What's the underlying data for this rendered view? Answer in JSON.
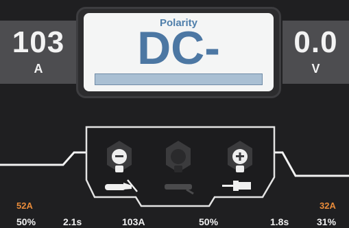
{
  "left_readout": {
    "value": "103",
    "unit": "A"
  },
  "right_readout": {
    "value": "0.0",
    "unit": "V"
  },
  "polarity": {
    "title": "Polarity",
    "value": "DC-"
  },
  "connectors": [
    {
      "symbol": "−",
      "icon": "electrode-holder-icon",
      "active": true
    },
    {
      "symbol": "",
      "icon": "ground-clamp-icon",
      "active": false
    },
    {
      "symbol": "+",
      "icon": "work-clamp-icon",
      "active": true
    }
  ],
  "bottom": {
    "start_current": "52A",
    "end_current": "32A",
    "labels": [
      "50%",
      "2.1s",
      "103A",
      "50%",
      "1.8s",
      "31%"
    ]
  },
  "colors": {
    "background": "#1f1f21",
    "accent_blue": "#4c77a3",
    "accent_orange": "#e88b3a"
  }
}
